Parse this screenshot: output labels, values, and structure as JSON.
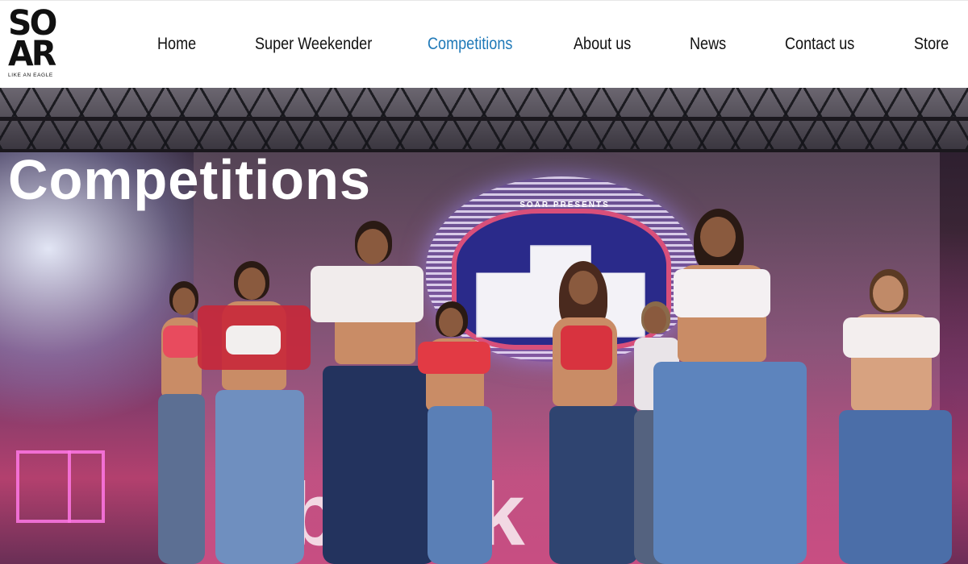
{
  "brand": {
    "logo_line1": "SO",
    "logo_line2": "AR",
    "tagline": "LIKE AN EAGLE"
  },
  "nav": {
    "items": [
      {
        "label": "Home"
      },
      {
        "label": "Super Weekender"
      },
      {
        "label": "Competitions",
        "active": true
      },
      {
        "label": "About us"
      },
      {
        "label": "News"
      },
      {
        "label": "Contact us"
      },
      {
        "label": "Store"
      }
    ],
    "active_color": "#1f79b8",
    "text_color": "#111111"
  },
  "hero": {
    "title": "Competitions",
    "image_alt": "Dancers performing on stage in front of a SOAR PRESENTS screen",
    "screen_badge_text": "SOAR PRESENTS",
    "sponsor_text": "Sblock"
  }
}
